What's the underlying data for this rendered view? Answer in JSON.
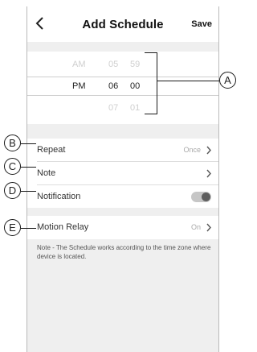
{
  "header": {
    "back_icon": "chevron-left-icon",
    "title": "Add Schedule",
    "save_label": "Save"
  },
  "time_picker": {
    "rows": [
      {
        "ampm": "AM",
        "hour": "05",
        "minute": "59"
      },
      {
        "ampm": "PM",
        "hour": "06",
        "minute": "00"
      },
      {
        "ampm": "",
        "hour": "07",
        "minute": "01"
      }
    ]
  },
  "settings": {
    "repeat": {
      "label": "Repeat",
      "value": "Once"
    },
    "note": {
      "label": "Note"
    },
    "notification": {
      "label": "Notification",
      "enabled": false
    },
    "motion_relay": {
      "label": "Motion Relay",
      "value": "On"
    }
  },
  "footer_note": "Note - The Schedule works according to the time zone where device is located.",
  "callouts": {
    "a": "A",
    "b": "B",
    "c": "C",
    "d": "D",
    "e": "E"
  }
}
